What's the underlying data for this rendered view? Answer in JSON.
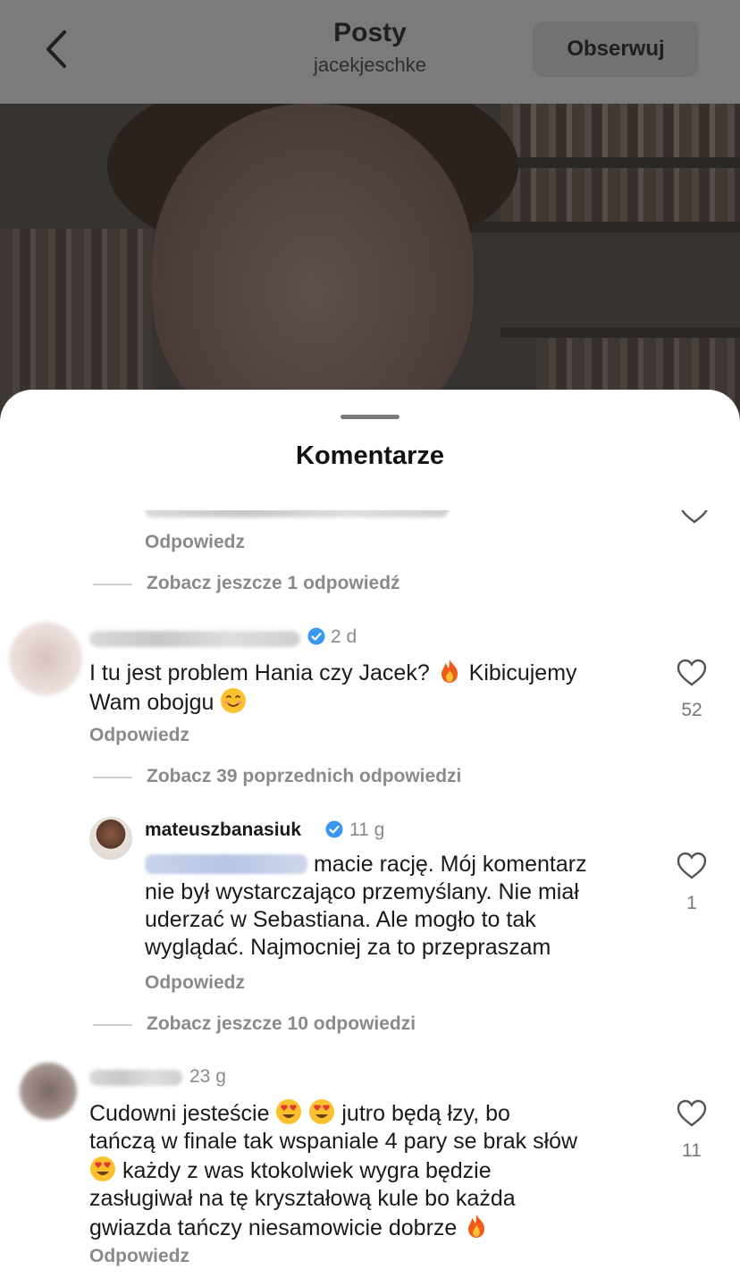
{
  "header": {
    "title": "Posty",
    "username": "jacekjeschke",
    "follow_label": "Obserwuj"
  },
  "sheet": {
    "title": "Komentarze"
  },
  "comments": [
    {
      "reply_label": "Odpowiedz",
      "more_replies": "Zobacz jeszcze 1 odpowiedź"
    },
    {
      "time": "2 d",
      "text_part1": "I tu jest problem Hania czy Jacek?",
      "text_part2": "Kibicujemy",
      "text_part3": "Wam obojgu",
      "likes": "52",
      "reply_label": "Odpowiedz",
      "more_replies": "Zobacz 39 poprzednich odpowiedzi"
    },
    {
      "username": "mateuszbanasiuk",
      "time": "11 g",
      "line1": "macie rację. Mój komentarz",
      "line2": "nie był wystarczająco przemyślany. Nie miał",
      "line3": "uderzać w Sebastiana. Ale mogło to tak",
      "line4": "wyglądać. Najmocniej za to przepraszam",
      "likes": "1",
      "reply_label": "Odpowiedz",
      "more_replies": "Zobacz jeszcze 10 odpowiedzi"
    },
    {
      "time": "23 g",
      "line1a": "Cudowni jesteście",
      "line1b": "jutro będą łzy, bo",
      "line2": "tańczą w finale tak wspaniale 4 pary se brak słów",
      "line3": "każdy z was ktokolwiek wygra będzie",
      "line4": "zasługiwał na tę kryształową kule bo każda",
      "line5": "gwiazda tańczy niesamowicie dobrze",
      "likes": "11",
      "reply_label": "Odpowiedz"
    }
  ],
  "icons": {
    "back": "chevron-left-icon",
    "like": "heart-outline-icon",
    "verified": "verified-badge-icon",
    "fire": "fire-emoji",
    "smile": "smiling-emoji",
    "heart_eyes": "heart-eyes-emoji"
  },
  "colors": {
    "verified": "#3897f0",
    "secondary_text": "#8a8a8a",
    "overlay": "#7b7b7b"
  }
}
